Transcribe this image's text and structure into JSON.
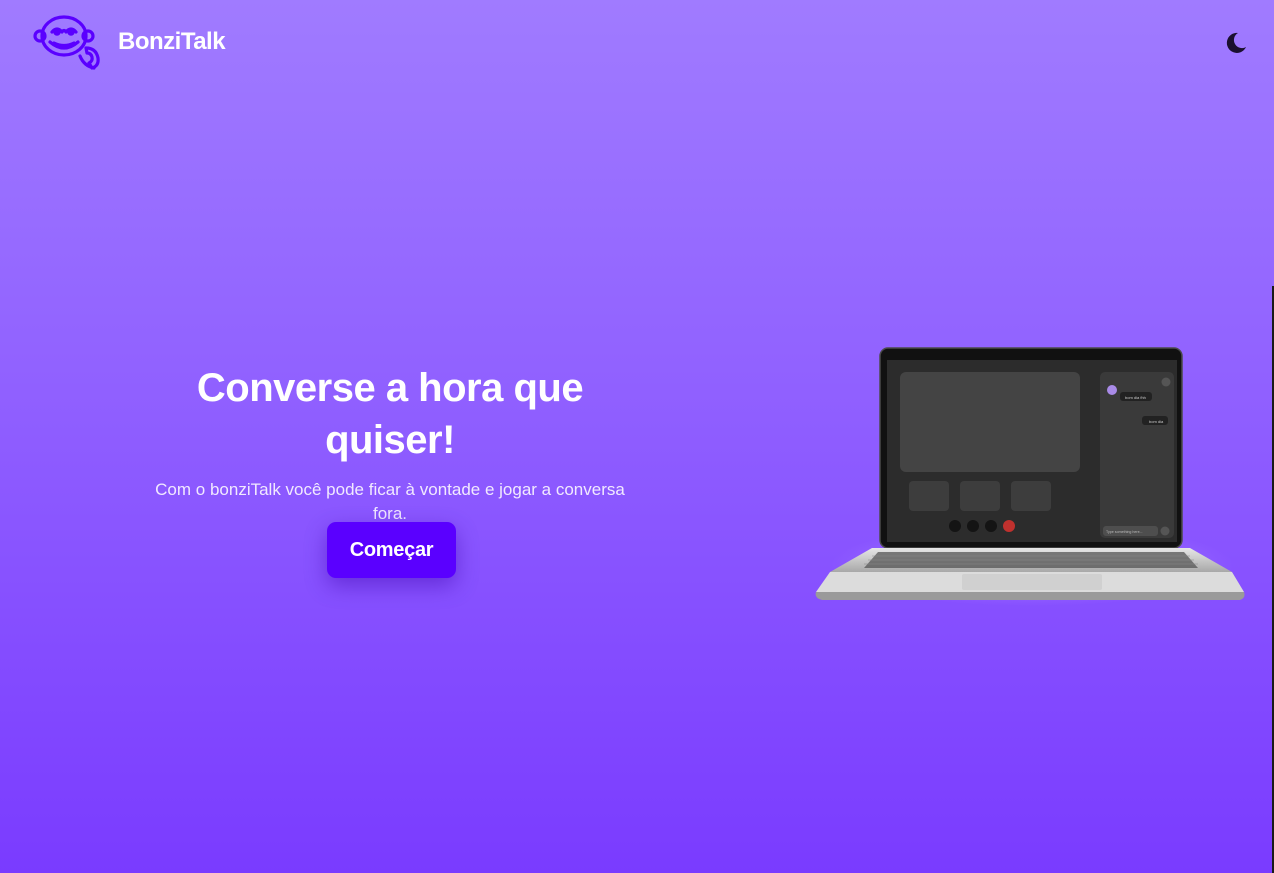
{
  "header": {
    "brand": "BonziTalk",
    "logo_icon": "monkey-phone-logo",
    "theme_toggle_icon": "moon-icon"
  },
  "hero": {
    "title": "Converse a hora que quiser!",
    "subtitle": "Com o bonziTalk você pode ficar à vontade e jogar a conversa fora.",
    "cta_label": "Começar"
  },
  "mockup": {
    "chat_messages": [
      "bom dia fhh",
      "bom dia"
    ],
    "input_placeholder": "Type something here..."
  },
  "colors": {
    "background_top": "#a07bff",
    "background_bottom": "#7a3bff",
    "button": "#5a00ff",
    "logo": "#5a00ff",
    "text": "#ffffff"
  }
}
